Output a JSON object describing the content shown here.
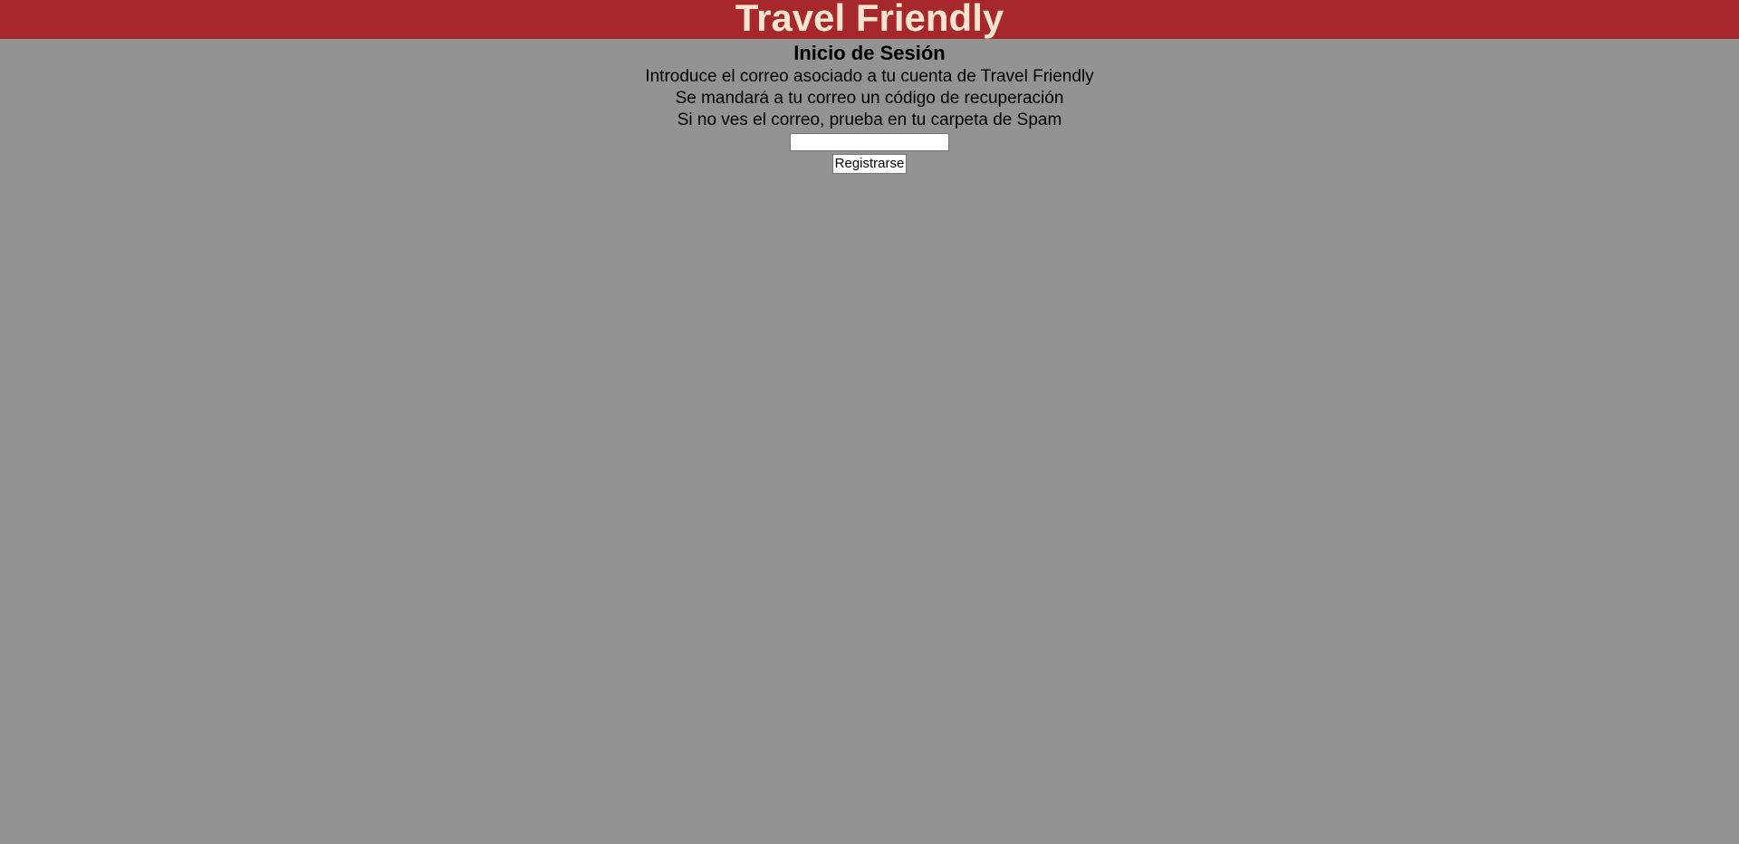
{
  "header": {
    "site_title": "Travel Friendly"
  },
  "main": {
    "page_title": "Inicio de Sesión",
    "instructions": [
      "Introduce el correo asociado a tu cuenta de Travel Friendly",
      "Se mandará a tu correo un código de recuperación",
      "Si no ves el correo, prueba en tu carpeta de Spam"
    ],
    "email_input": {
      "value": "",
      "placeholder": ""
    },
    "submit_label": "Registrarse"
  },
  "colors": {
    "header_background": "#a6282c",
    "header_text": "#f7e4cf",
    "page_background": "#939393"
  }
}
